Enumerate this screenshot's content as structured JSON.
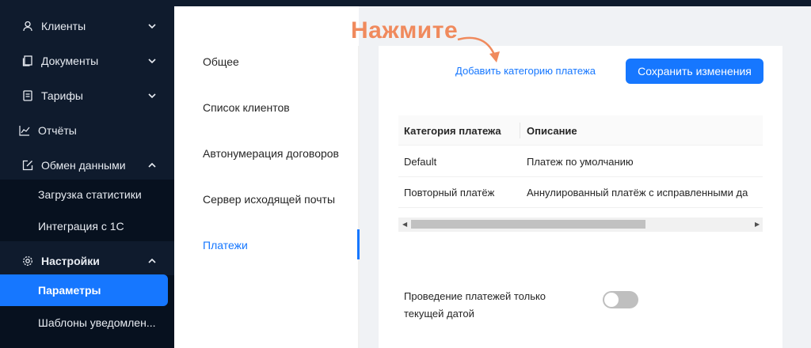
{
  "sidebar": {
    "items": [
      {
        "label": "Клиенты",
        "icon": "user-icon"
      },
      {
        "label": "Документы",
        "icon": "documents-icon"
      },
      {
        "label": "Тарифы",
        "icon": "tariff-icon"
      },
      {
        "label": "Отчёты",
        "icon": "chart-icon"
      },
      {
        "label": "Обмен данными",
        "icon": "data-exchange-icon"
      },
      {
        "label": "Настройки",
        "icon": "gear-icon"
      }
    ],
    "exchange_sub": [
      "Загрузка статистики",
      "Интеграция с 1С"
    ],
    "settings_sub": [
      "Параметры",
      "Шаблоны уведомлен..."
    ]
  },
  "settings_menu": {
    "items": [
      "Общее",
      "Список клиентов",
      "Автонумерация договоров",
      "Сервер исходящей почты",
      "Платежи"
    ]
  },
  "content": {
    "add_link": "Добавить категорию платежа",
    "save_button": "Сохранить изменения",
    "table": {
      "headers": [
        "Категория платежа",
        "Описание"
      ],
      "rows": [
        [
          "Default",
          "Платеж по умолчанию"
        ],
        [
          "Повторный платёж",
          "Аннулированный платёж с исправленными да"
        ]
      ]
    },
    "toggle_label": "Проведение платежей только текущей датой",
    "toggle_on": false
  },
  "annotation": {
    "text": "Нажмите",
    "color": "#f08a5d"
  },
  "colors": {
    "accent": "#1677ff",
    "sidebar_bg": "#0f1b2d"
  }
}
